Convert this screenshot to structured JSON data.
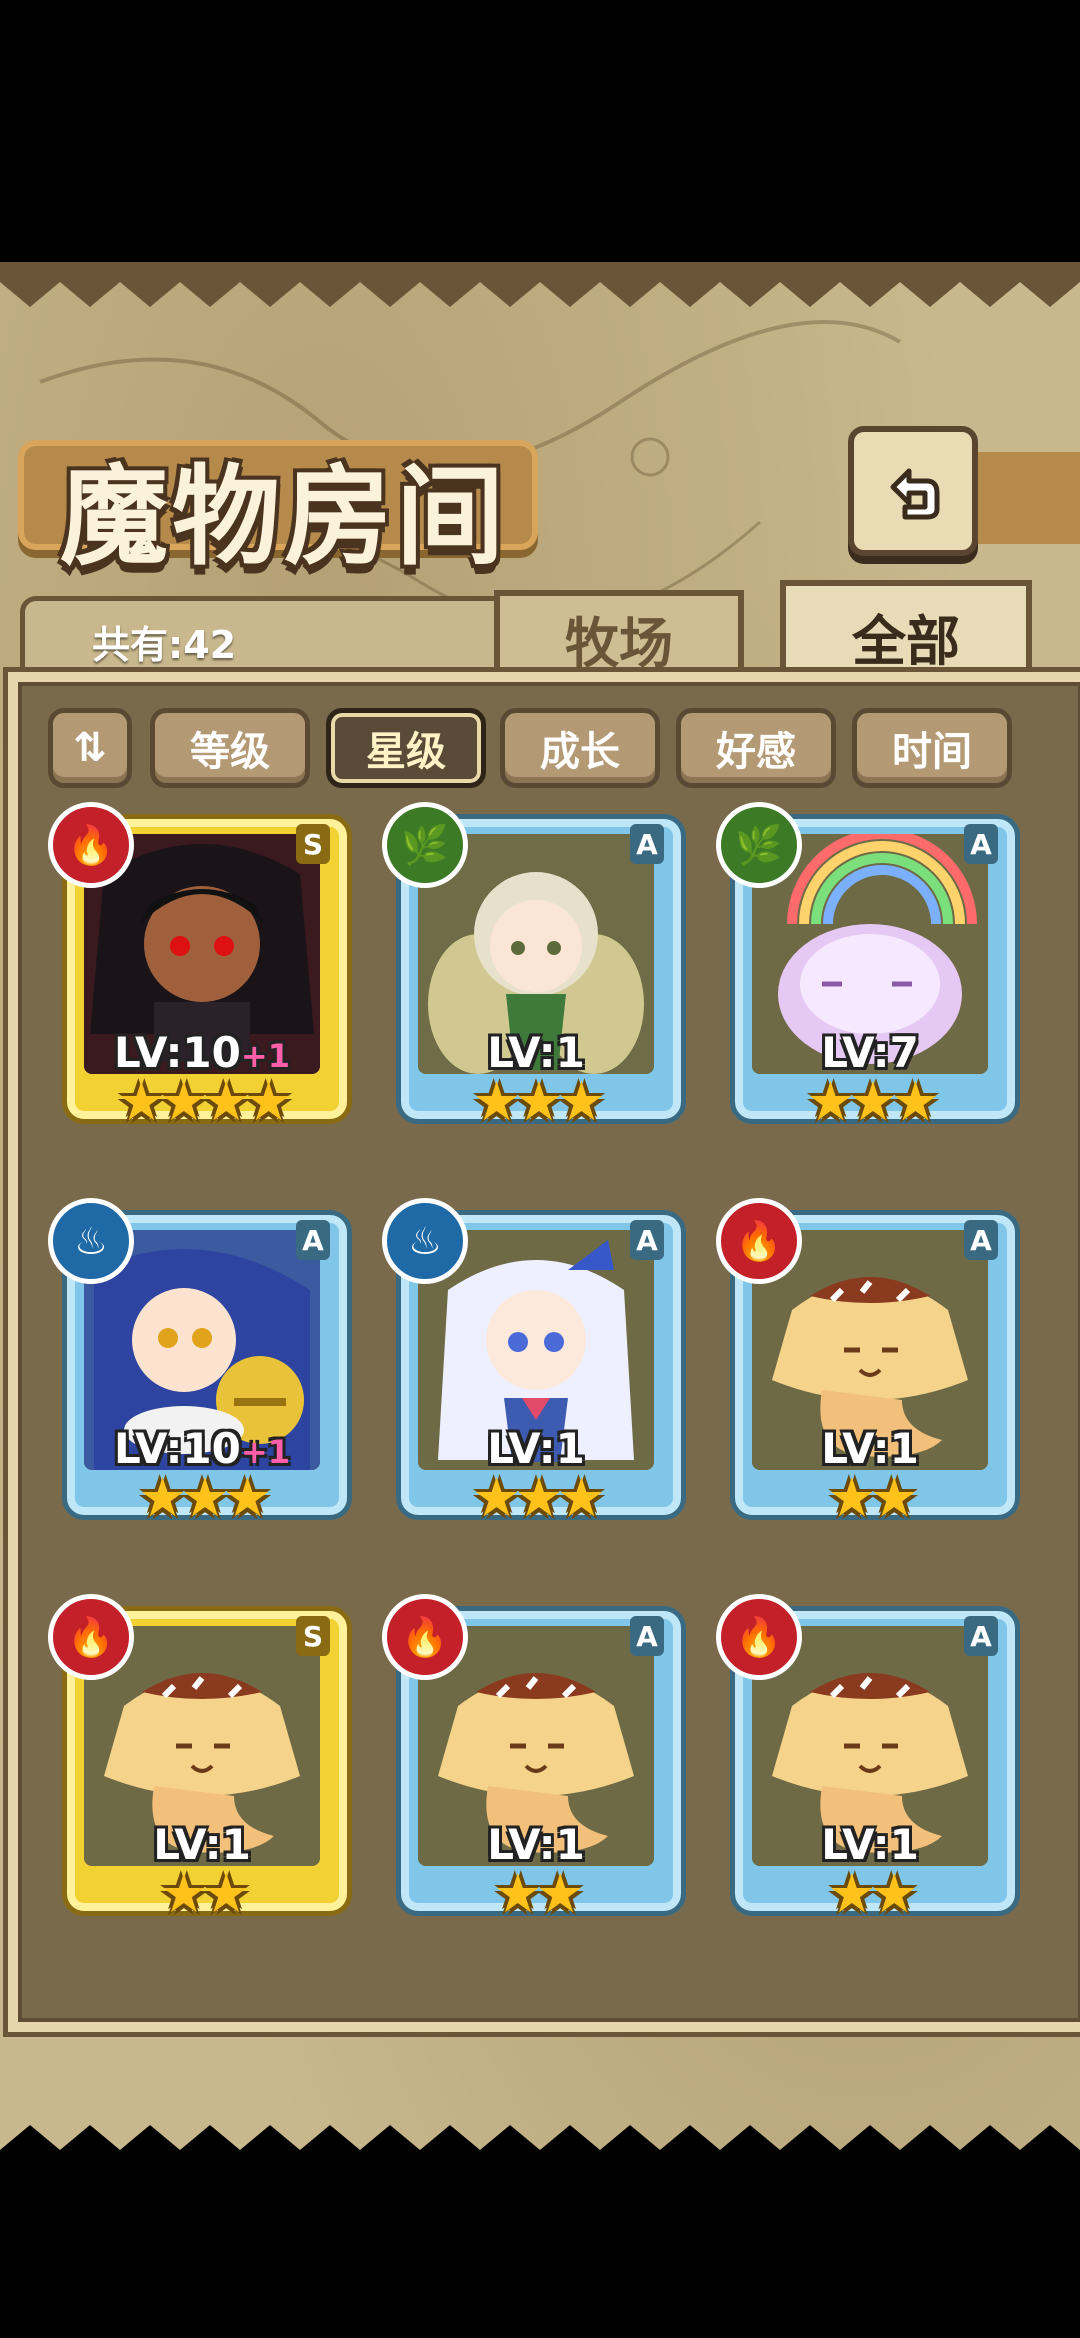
{
  "header": {
    "title": "魔物房间",
    "back_icon": "return-arrow-icon"
  },
  "info": {
    "count_label": "共有:42"
  },
  "tabs": [
    {
      "label": "牧场",
      "active": false
    },
    {
      "label": "全部",
      "active": true
    }
  ],
  "sort": {
    "toggle_icon": "sort-order-icon",
    "buttons": [
      {
        "label": "等级",
        "active": false
      },
      {
        "label": "星级",
        "active": true
      },
      {
        "label": "成长",
        "active": false
      },
      {
        "label": "好感",
        "active": false
      },
      {
        "label": "时间",
        "active": false
      }
    ]
  },
  "monsters": [
    {
      "rank": "S",
      "element": "fire",
      "element_icon": "fire-element-icon",
      "level": "LV:10",
      "plus": "+1",
      "stars": "★★★★",
      "star_count": 4,
      "frame": "gold",
      "portrait": "dark-demon-girl"
    },
    {
      "rank": "A",
      "element": "nature",
      "element_icon": "leaf-element-icon",
      "level": "LV:1",
      "plus": "",
      "stars": "★★★",
      "star_count": 3,
      "frame": "blue",
      "portrait": "fairy-girl"
    },
    {
      "rank": "A",
      "element": "nature",
      "element_icon": "leaf-element-icon",
      "level": "LV:7",
      "plus": "",
      "stars": "★★★",
      "star_count": 3,
      "frame": "blue",
      "portrait": "rainbow-slime"
    },
    {
      "rank": "A",
      "element": "water",
      "element_icon": "water-element-icon",
      "level": "LV:10",
      "plus": "+1",
      "stars": "★★★",
      "star_count": 3,
      "frame": "blue",
      "portrait": "blue-cat-girl"
    },
    {
      "rank": "A",
      "element": "water",
      "element_icon": "water-element-icon",
      "level": "LV:1",
      "plus": "",
      "stars": "★★★",
      "star_count": 3,
      "frame": "blue",
      "portrait": "white-bunny-girl"
    },
    {
      "rank": "A",
      "element": "fire",
      "element_icon": "fire-element-icon",
      "level": "LV:1",
      "plus": "",
      "stars": "★★",
      "star_count": 2,
      "frame": "blue",
      "portrait": "pudding-blob"
    },
    {
      "rank": "S",
      "element": "fire",
      "element_icon": "fire-element-icon",
      "level": "LV:1",
      "plus": "",
      "stars": "★★",
      "star_count": 2,
      "frame": "gold",
      "portrait": "pudding-blob"
    },
    {
      "rank": "A",
      "element": "fire",
      "element_icon": "fire-element-icon",
      "level": "LV:1",
      "plus": "",
      "stars": "★★",
      "star_count": 2,
      "frame": "blue",
      "portrait": "pudding-blob"
    },
    {
      "rank": "A",
      "element": "fire",
      "element_icon": "fire-element-icon",
      "level": "LV:1",
      "plus": "",
      "stars": "★★",
      "star_count": 2,
      "frame": "blue",
      "portrait": "pudding-blob"
    }
  ]
}
